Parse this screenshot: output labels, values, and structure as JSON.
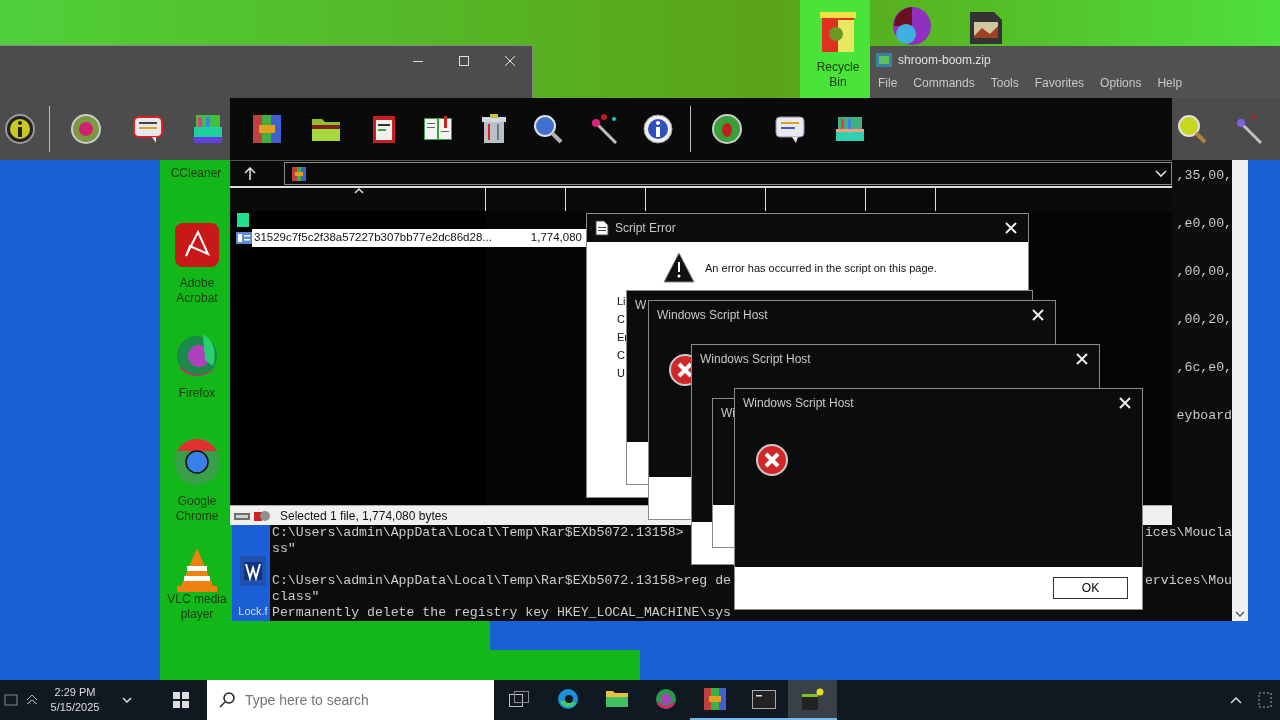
{
  "desktop_icons": [
    {
      "label": "Recycle Bin",
      "kind": "bin"
    },
    {
      "label": "CCleaner",
      "kind": "hidden"
    },
    {
      "label": "Adobe Acrobat",
      "kind": "pdf"
    },
    {
      "label": "Firefox",
      "kind": "fox"
    },
    {
      "label": "Google Chrome",
      "kind": "chrome"
    },
    {
      "label": "VLC media player",
      "kind": "cone"
    },
    {
      "label": "Lock.f",
      "kind": "doc"
    }
  ],
  "winrar": {
    "title": "shroom-boom.zip",
    "menu": [
      "File",
      "Commands",
      "Tools",
      "Favorites",
      "Options",
      "Help"
    ],
    "files": [
      {
        "name": "31529c7f5c2f38a57227b307bb77e2dc86d28...",
        "size": "1,774,080",
        "selected": true
      }
    ],
    "status": "Selected 1 file, 1,774,080 bytes"
  },
  "console": {
    "right_fragments": [
      ",35,00,",
      ",e0,00,",
      ",00,00,",
      ",00,20,",
      ",6c,e0,",
      "eyboard"
    ],
    "lines": [
      {
        "kind": "text",
        "start": "C:\\Users\\admin\\AppData\\Local\\Temp\\Rar$EXb5072.13158>",
        "end": "ices\\Moucla"
      },
      {
        "kind": "text",
        "start": "ss\""
      },
      {
        "kind": "blank"
      },
      {
        "kind": "text",
        "start": "C:\\Users\\admin\\AppData\\Local\\Temp\\Rar$EXb5072.13158>reg de",
        "end": "ervices\\Mou"
      },
      {
        "kind": "text",
        "start": "class\""
      },
      {
        "kind": "text",
        "start": "Permanently delete the registry key HKEY_LOCAL_MACHINE\\sys"
      }
    ]
  },
  "script_error": {
    "title": "Script Error",
    "message": "An error has occurred in the script on this page.",
    "labels": [
      "Li",
      "C",
      "Er",
      "C",
      "U"
    ]
  },
  "wsh_dialogs": [
    {
      "title": "W"
    },
    {
      "title": "Windows Script Host"
    },
    {
      "title": "Windows Script Host"
    },
    {
      "title": "Wi"
    },
    {
      "title": "Windows Script Host",
      "button": "OK"
    }
  ],
  "taskbar": {
    "time": "2:29 PM",
    "date": "5/15/2025",
    "search_placeholder": "Type here to search",
    "apps": [
      {
        "kind": "taskview",
        "running": false,
        "active": false
      },
      {
        "kind": "edge",
        "running": false,
        "active": false
      },
      {
        "kind": "files",
        "running": false,
        "active": false
      },
      {
        "kind": "fox",
        "running": false,
        "active": false
      },
      {
        "kind": "archive",
        "running": true,
        "active": false
      },
      {
        "kind": "console",
        "running": true,
        "active": false
      },
      {
        "kind": "package",
        "running": true,
        "active": true
      }
    ]
  }
}
